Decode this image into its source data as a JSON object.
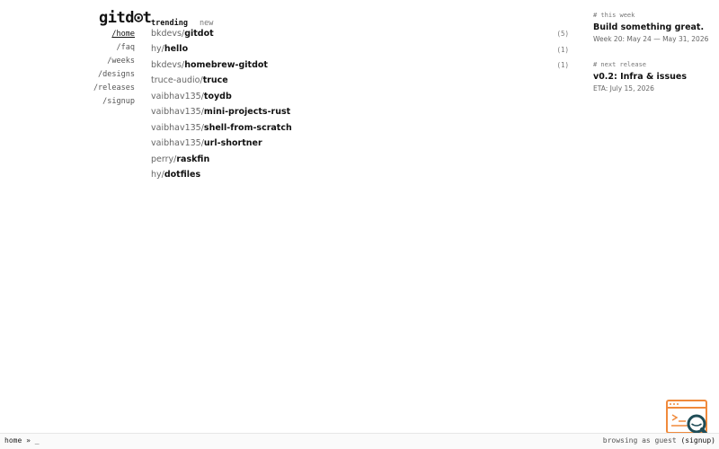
{
  "brand": {
    "logo": "gitd⊙t"
  },
  "nav": {
    "items": [
      {
        "label": "/home",
        "active": true
      },
      {
        "label": "/faq"
      },
      {
        "label": "/weeks"
      },
      {
        "label": "/designs"
      },
      {
        "label": "/releases"
      },
      {
        "label": "/signup"
      }
    ]
  },
  "tabs": {
    "trending": "trending",
    "new": "new"
  },
  "repos": [
    {
      "owner": "bkdevs/",
      "name": "gitdot",
      "count": "(5)"
    },
    {
      "owner": "hy/",
      "name": "hello",
      "count": "(1)"
    },
    {
      "owner": "bkdevs/",
      "name": "homebrew-gitdot",
      "count": "(1)"
    },
    {
      "owner": "truce-audio/",
      "name": "truce",
      "count": ""
    },
    {
      "owner": "vaibhav135/",
      "name": "toydb",
      "count": ""
    },
    {
      "owner": "vaibhav135/",
      "name": "mini-projects-rust",
      "count": ""
    },
    {
      "owner": "vaibhav135/",
      "name": "shell-from-scratch",
      "count": ""
    },
    {
      "owner": "vaibhav135/",
      "name": "url-shortner",
      "count": ""
    },
    {
      "owner": "perry/",
      "name": "raskfin",
      "count": ""
    },
    {
      "owner": "hy/",
      "name": "dotfiles",
      "count": ""
    }
  ],
  "this_week": {
    "heading": "# this week",
    "title": "Build something great.",
    "sub": "Week 20: May 24 — May 31, 2026"
  },
  "next_release": {
    "heading": "# next release",
    "title": "v0.2: Infra & issues",
    "sub": "ETA: July 15, 2026"
  },
  "bottom": {
    "breadcrumb": "home » _",
    "status": "browsing as guest",
    "signup": "(signup)"
  },
  "colors": {
    "accent": "#f08a3c",
    "text": "#111111",
    "muted": "#666666"
  },
  "icons": {
    "float": "search-window-icon"
  }
}
